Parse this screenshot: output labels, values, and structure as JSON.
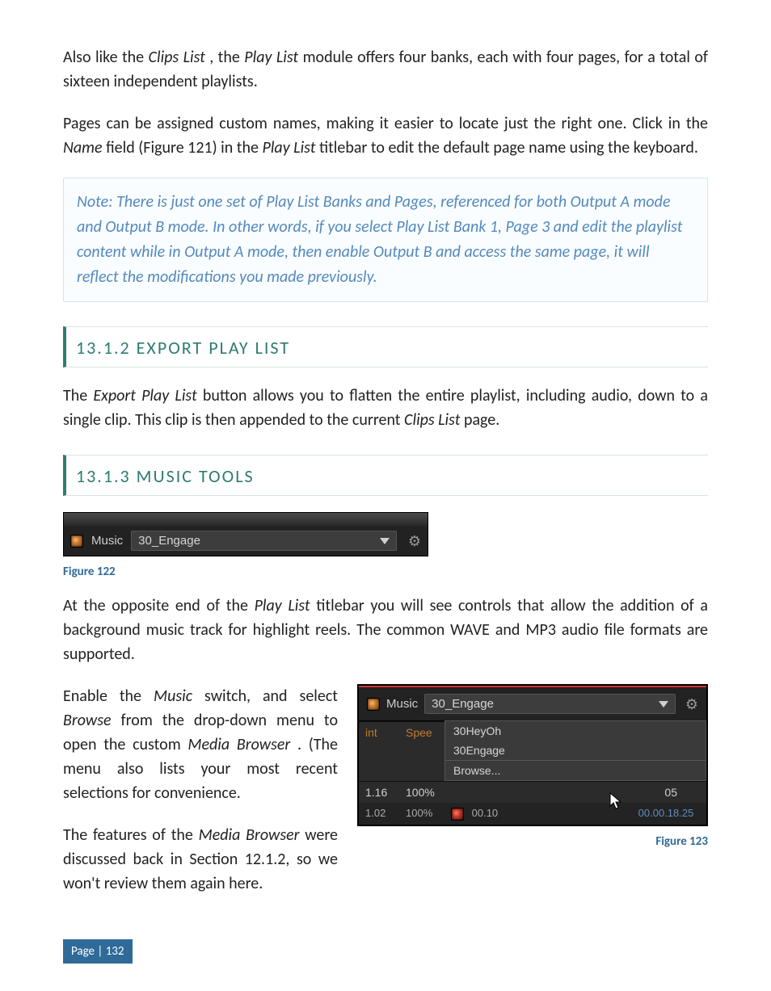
{
  "para1_a": "Also like the ",
  "para1_b": "Clips List",
  "para1_c": ", the ",
  "para1_d": "Play List",
  "para1_e": " module offers four banks, each with four pages, for a total of sixteen independent playlists.",
  "para2_a": "Pages can be assigned custom names, making it easier to locate just the right one.  Click in the ",
  "para2_b": "Name",
  "para2_c": " field (Figure 121) in the ",
  "para2_d": "Play List",
  "para2_e": " titlebar to edit the default page name using the keyboard.",
  "note": "Note: There is just one set of Play List Banks and Pages, referenced for both Output A mode and Output B mode.  In other words, if you select Play List Bank 1, Page 3 and edit the playlist content while in Output A mode, then enable Output B and access the same page, it will reflect the modifications you made previously.",
  "sec1_title": "13.1.2 EXPORT PLAY LIST",
  "sec1_p_a": "The ",
  "sec1_p_b": "Export Play List",
  "sec1_p_c": " button allows you to flatten the entire playlist, including audio, down to a single clip.  This clip is then appended to the current ",
  "sec1_p_d": "Clips List",
  "sec1_p_e": " page.",
  "sec2_title": "13.1.3 MUSIC TOOLS",
  "fig1": {
    "music_label": "Music",
    "track": "30_Engage",
    "caption": "Figure 122"
  },
  "para3_a": "At the opposite end of the ",
  "para3_b": "Play List",
  "para3_c": " titlebar you will see controls that allow the addition of a background music track for highlight reels.  The common WAVE and MP3 audio file formats are supported.",
  "para4_a": "Enable the ",
  "para4_b": "Music",
  "para4_c": " switch, and select ",
  "para4_d": "Browse",
  "para4_e": " from the drop-down menu to open the custom ",
  "para4_f": "Media Browser",
  "para4_g": ".  (The menu also lists your most recent selections for convenience.",
  "para5_a": "The features of the ",
  "para5_b": "Media Browser",
  "para5_c": " were discussed back in Section 12.1.2, so we won't review them again here.",
  "fig2": {
    "music_label": "Music",
    "track": "30_Engage",
    "col_int": "int",
    "col_speed": "Spee",
    "menu": {
      "item1": "30HeyOh",
      "item2": "30Engage",
      "browse": "Browse..."
    },
    "row1_a": "1.16",
    "row1_b": "100%",
    "row1_e": "05",
    "row2_a": "1.02",
    "row2_b": "100%",
    "row2_in": "00.10",
    "row2_out": "00.00.18.25",
    "caption": "Figure 123"
  },
  "footer": "Page | 132"
}
